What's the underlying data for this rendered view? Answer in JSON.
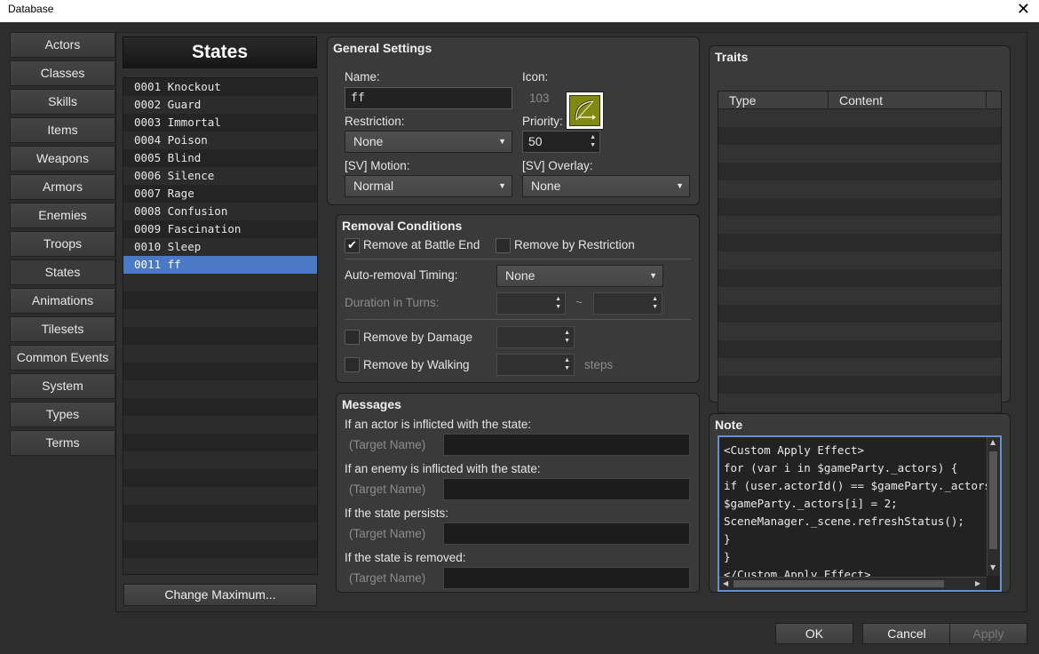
{
  "window": {
    "title": "Database",
    "close_glyph": "✕"
  },
  "nav": {
    "items": [
      "Actors",
      "Classes",
      "Skills",
      "Items",
      "Weapons",
      "Armors",
      "Enemies",
      "Troops",
      "States",
      "Animations",
      "Tilesets",
      "Common Events",
      "System",
      "Types",
      "Terms"
    ],
    "active": "States"
  },
  "list": {
    "header": "States",
    "items": [
      "0001 Knockout",
      "0002 Guard",
      "0003 Immortal",
      "0004 Poison",
      "0005 Blind",
      "0006 Silence",
      "0007 Rage",
      "0008 Confusion",
      "0009 Fascination",
      "0010 Sleep",
      "0011 ff"
    ],
    "selected_index": 10,
    "change_max_label": "Change Maximum..."
  },
  "general": {
    "title": "General Settings",
    "name_label": "Name:",
    "name_value": "ff",
    "icon_label": "Icon:",
    "icon_index": "103",
    "icon_name": "bow-icon",
    "restriction_label": "Restriction:",
    "restriction_value": "None",
    "priority_label": "Priority:",
    "priority_value": "50",
    "sv_motion_label": "[SV] Motion:",
    "sv_motion_value": "Normal",
    "sv_overlay_label": "[SV] Overlay:",
    "sv_overlay_value": "None"
  },
  "removal": {
    "title": "Removal Conditions",
    "battle_end_label": "Remove at Battle End",
    "battle_end_checked": true,
    "restriction_label": "Remove by Restriction",
    "restriction_checked": false,
    "auto_timing_label": "Auto-removal Timing:",
    "auto_timing_value": "None",
    "duration_label": "Duration in Turns:",
    "tilde": "~",
    "damage_label": "Remove by Damage",
    "damage_checked": false,
    "walking_label": "Remove by Walking",
    "walking_checked": false,
    "steps_label": "steps"
  },
  "messages": {
    "title": "Messages",
    "actor_label": "If an actor is inflicted with the state:",
    "enemy_label": "If an enemy is inflicted with the state:",
    "persist_label": "If the state persists:",
    "removed_label": "If the state is removed:",
    "target_name": "(Target Name)"
  },
  "traits": {
    "title": "Traits",
    "col_type": "Type",
    "col_content": "Content"
  },
  "note": {
    "title": "Note",
    "text": "<Custom Apply Effect>\nfor (var i in $gameParty._actors) {\nif (user.actorId() == $gameParty._actors[i]\n$gameParty._actors[i] = 2;\nSceneManager._scene.refreshStatus();\n}\n}\n</Custom Apply Effect>"
  },
  "footer": {
    "ok": "OK",
    "cancel": "Cancel",
    "apply": "Apply"
  },
  "colors": {
    "selection": "#4a7ac6",
    "note_border": "#6b8fc9",
    "icon_bg": "#808a12"
  }
}
